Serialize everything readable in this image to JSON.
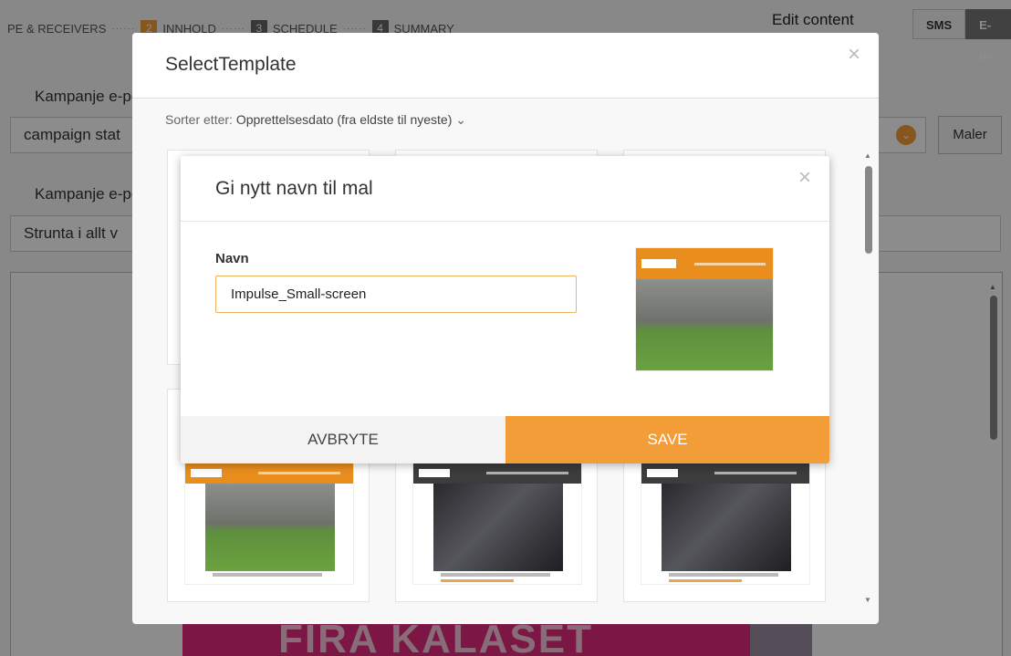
{
  "stepper": {
    "steps": [
      {
        "num": "",
        "label": "PE & RECEIVERS"
      },
      {
        "num": "2",
        "label": "INNHOLD"
      },
      {
        "num": "3",
        "label": "SCHEDULE"
      },
      {
        "num": "4",
        "label": "SUMMARY"
      }
    ],
    "active_index": 1
  },
  "header": {
    "edit_content": "Edit content",
    "tabs": [
      "SMS",
      "E-po"
    ]
  },
  "form": {
    "field1_label": "Kampanje e-po",
    "field1_value": "campaign stat",
    "maler_button": "Maler",
    "field2_label": "Kampanje e-pos",
    "field2_value": "Strunta i allt v"
  },
  "banner": {
    "text": "FIRA KALASET"
  },
  "select_template": {
    "title": "SelectTemplate",
    "close": "×",
    "sort_label": "Sorter etter:",
    "sort_value": "Opprettelsesdato (fra eldste til nyeste)",
    "templates": [
      {
        "brand": "IMPULSE",
        "style": "orange"
      },
      {
        "brand": "wellness",
        "style": "dark"
      },
      {
        "brand": "wellness",
        "style": "dark"
      }
    ]
  },
  "rename_dialog": {
    "title": "Gi nytt navn til mal",
    "close": "×",
    "name_label": "Navn",
    "name_value": "Impulse_Small-screen",
    "cancel_button": "AVBRYTE",
    "save_button": "SAVE"
  },
  "colors": {
    "accent_orange": "#f29d38",
    "overlay": "rgba(0,0,0,0.45)"
  },
  "icons": {
    "close": "close-icon",
    "chevron": "chevron-down-icon"
  }
}
